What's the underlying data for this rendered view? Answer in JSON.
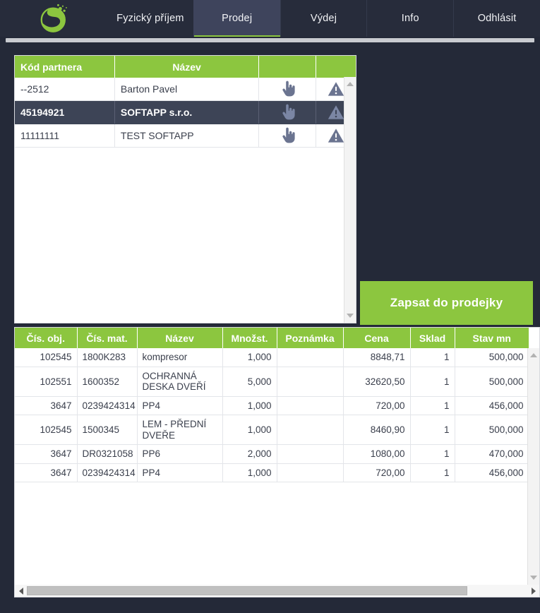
{
  "app": {
    "logo_icon": "leaf-s-logo-icon",
    "accent_green": "#8cc63f",
    "dark_bg": "#242938",
    "nav_bg": "#272c3b",
    "active_tab_bg": "#3e445c",
    "selected_row_bg": "#3d4456"
  },
  "nav": {
    "items": [
      {
        "label": "Fyzický příjem",
        "active": false
      },
      {
        "label": "Prodej",
        "active": true
      },
      {
        "label": "Výdej",
        "active": false
      },
      {
        "label": "Info",
        "active": false
      },
      {
        "label": "Odhlásit",
        "active": false
      }
    ]
  },
  "partner_table": {
    "headers": [
      "Kód partnera",
      "Název",
      "",
      ""
    ],
    "icons": {
      "action": "hand-pointer-icon",
      "warning": "warning-triangle-icon"
    },
    "rows": [
      {
        "code": "--2512",
        "name": "Barton Pavel",
        "selected": false
      },
      {
        "code": "45194921",
        "name": "SOFTAPP s.r.o.",
        "selected": true
      },
      {
        "code": "11111111",
        "name": "TEST SOFTAPP",
        "selected": false
      }
    ]
  },
  "actions": {
    "write_to_receipt": "Zapsat do prodejky"
  },
  "items_table": {
    "headers": [
      "Čís. obj.",
      "Čís. mat.",
      "Název",
      "Množst.",
      "Poznámka",
      "Cena",
      "Sklad",
      "Stav mn"
    ],
    "rows": [
      {
        "order_no": "102545",
        "material_no": "1800K283",
        "name": "kompresor",
        "quantity": "1,000",
        "note": "",
        "price": "8848,71",
        "warehouse": "1",
        "stock": "500,000"
      },
      {
        "order_no": "102551",
        "material_no": "1600352",
        "name": "OCHRANNÁ DESKA DVEŘÍ",
        "quantity": "5,000",
        "note": "",
        "price": "32620,50",
        "warehouse": "1",
        "stock": "500,000"
      },
      {
        "order_no": "3647",
        "material_no": "0239424314",
        "name": "PP4",
        "quantity": "1,000",
        "note": "",
        "price": "720,00",
        "warehouse": "1",
        "stock": "456,000"
      },
      {
        "order_no": "102545",
        "material_no": "1500345",
        "name": "LEM - PŘEDNÍ DVEŘE",
        "quantity": "1,000",
        "note": "",
        "price": "8460,90",
        "warehouse": "1",
        "stock": "500,000"
      },
      {
        "order_no": "3647",
        "material_no": "DR0321058",
        "name": "PP6",
        "quantity": "2,000",
        "note": "",
        "price": "1080,00",
        "warehouse": "1",
        "stock": "470,000"
      },
      {
        "order_no": "3647",
        "material_no": "0239424314",
        "name": "PP4",
        "quantity": "1,000",
        "note": "",
        "price": "720,00",
        "warehouse": "1",
        "stock": "456,000"
      }
    ]
  },
  "scrollbars": {
    "up_arrow_icon": "triangle-up-icon",
    "down_arrow_icon": "triangle-down-icon",
    "left_arrow_icon": "triangle-left-icon",
    "right_arrow_icon": "triangle-right-icon"
  }
}
